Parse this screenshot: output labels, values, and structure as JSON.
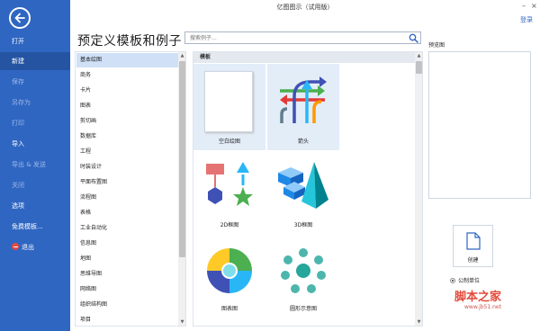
{
  "window": {
    "title": "亿图图示（试用版）",
    "login": "登录",
    "minimize": "–",
    "close": "×"
  },
  "nav": {
    "items": [
      {
        "label": "打开"
      },
      {
        "label": "新建"
      },
      {
        "label": "保存"
      },
      {
        "label": "另存为"
      },
      {
        "label": "打印"
      },
      {
        "label": "导入"
      },
      {
        "label": "导出 & 发送"
      },
      {
        "label": "关闭"
      },
      {
        "label": "选项"
      },
      {
        "label": "免费模板..."
      },
      {
        "label": "退出"
      }
    ]
  },
  "main": {
    "heading": "预定义模板和例子",
    "search": {
      "placeholder": "搜索例子..."
    },
    "categories": [
      "基本绘图",
      "商务",
      "卡片",
      "图表",
      "剪切画",
      "数据库",
      "工程",
      "时装设计",
      "平面布置图",
      "流程图",
      "表格",
      "工业自动化",
      "信息图",
      "地图",
      "思维导图",
      "网络图",
      "组织结构图",
      "项目"
    ],
    "section_title": "模板",
    "tiles": [
      {
        "label": "空白绘图"
      },
      {
        "label": "箭头"
      },
      {
        "label": "2D框图"
      },
      {
        "label": "3D框图"
      },
      {
        "label": "图表图"
      },
      {
        "label": "圆形示意图"
      }
    ]
  },
  "preview": {
    "label": "预览图"
  },
  "actions": {
    "create_label": "创建",
    "unit_label": "公制单位"
  },
  "watermark": {
    "text": "脚本之家",
    "url": "www.jb51.net"
  },
  "colors": {
    "nav_bg": "#2f66c2",
    "nav_active": "#2554a3",
    "selection": "#cfe0f7",
    "accent": "#2f66c2"
  }
}
